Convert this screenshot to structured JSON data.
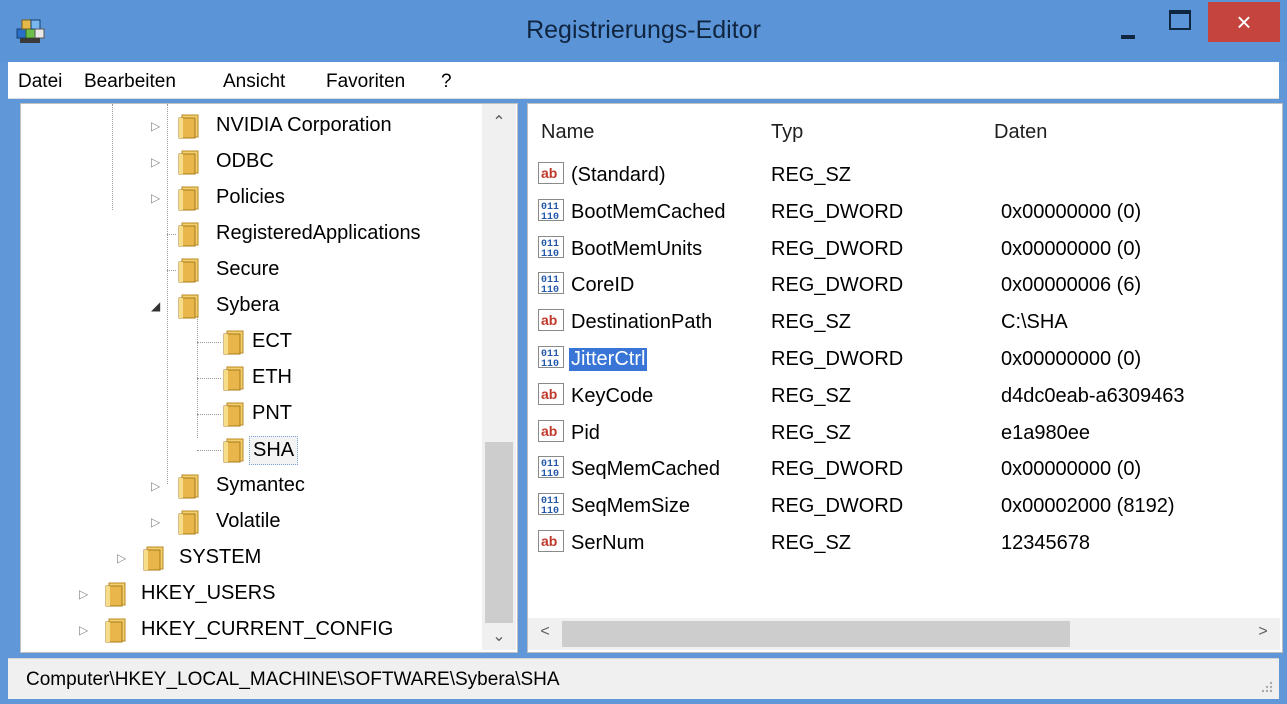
{
  "window": {
    "title": "Registrierungs-Editor",
    "close_glyph": "×"
  },
  "menu": [
    "Datei",
    "Bearbeiten",
    "Ansicht",
    "Favoriten",
    "?"
  ],
  "tree": {
    "items": [
      {
        "label": "NVIDIA Corporation",
        "expander": "▷"
      },
      {
        "label": "ODBC",
        "expander": "▷"
      },
      {
        "label": "Policies",
        "expander": "▷"
      },
      {
        "label": "RegisteredApplications",
        "expander": ""
      },
      {
        "label": "Secure",
        "expander": ""
      },
      {
        "label": "Sybera",
        "expander": "◢"
      },
      {
        "label": "ECT",
        "expander": ""
      },
      {
        "label": "ETH",
        "expander": ""
      },
      {
        "label": "PNT",
        "expander": ""
      },
      {
        "label": "SHA",
        "expander": "",
        "selected": true
      },
      {
        "label": "Symantec",
        "expander": "▷"
      },
      {
        "label": "Volatile",
        "expander": "▷"
      },
      {
        "label": "SYSTEM",
        "expander": "▷"
      },
      {
        "label": "HKEY_USERS",
        "expander": "▷"
      },
      {
        "label": "HKEY_CURRENT_CONFIG",
        "expander": "▷"
      }
    ]
  },
  "values": {
    "columns": [
      "Name",
      "Typ",
      "Daten"
    ],
    "rows": [
      {
        "icon": "string-value-icon",
        "name": "(Standard)",
        "type": "REG_SZ",
        "data": ""
      },
      {
        "icon": "binary-value-icon",
        "name": "BootMemCached",
        "type": "REG_DWORD",
        "data": "0x00000000 (0)"
      },
      {
        "icon": "binary-value-icon",
        "name": "BootMemUnits",
        "type": "REG_DWORD",
        "data": "0x00000000 (0)"
      },
      {
        "icon": "binary-value-icon",
        "name": "CoreID",
        "type": "REG_DWORD",
        "data": "0x00000006 (6)"
      },
      {
        "icon": "string-value-icon",
        "name": "DestinationPath",
        "type": "REG_SZ",
        "data": "C:\\SHA"
      },
      {
        "icon": "binary-value-icon",
        "name": "JitterCtrl",
        "type": "REG_DWORD",
        "data": "0x00000000 (0)",
        "selected": true
      },
      {
        "icon": "string-value-icon",
        "name": "KeyCode",
        "type": "REG_SZ",
        "data": "d4dc0eab-a6309463"
      },
      {
        "icon": "string-value-icon",
        "name": "Pid",
        "type": "REG_SZ",
        "data": "e1a980ee"
      },
      {
        "icon": "binary-value-icon",
        "name": "SeqMemCached",
        "type": "REG_DWORD",
        "data": "0x00000000 (0)"
      },
      {
        "icon": "binary-value-icon",
        "name": "SeqMemSize",
        "type": "REG_DWORD",
        "data": "0x00002000 (8192)"
      },
      {
        "icon": "string-value-icon",
        "name": "SerNum",
        "type": "REG_SZ",
        "data": "12345678"
      }
    ]
  },
  "status": {
    "path": "Computer\\HKEY_LOCAL_MACHINE\\SOFTWARE\\Sybera\\SHA"
  },
  "colors": {
    "titlebar": "#5b95d8",
    "close": "#c5443d",
    "selection": "#3875d7",
    "folder": "#e8b64a"
  }
}
